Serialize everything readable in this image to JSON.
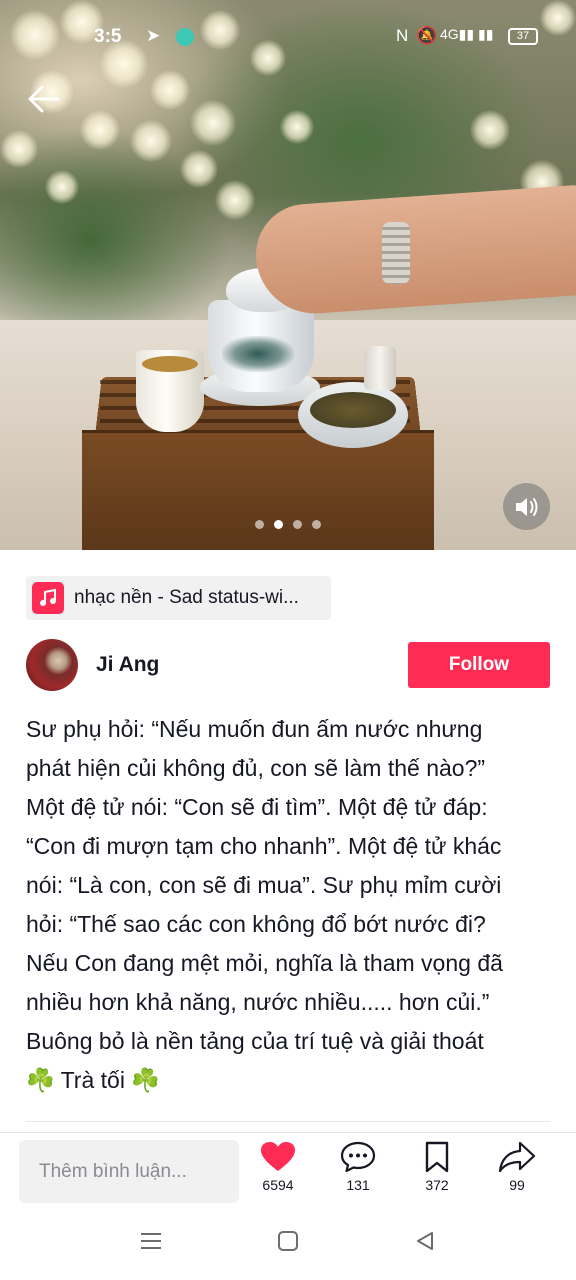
{
  "status_bar": {
    "time": "3:5",
    "battery": "37"
  },
  "music": {
    "label": "nhạc nền - Sad status-wi..."
  },
  "author": {
    "name": "Ji Ang",
    "follow_label": "Follow"
  },
  "caption": {
    "lines": [
      "Sư phụ hỏi: “Nếu muốn đun ấm nước nhưng",
      "phát hiện củi không đủ, con sẽ làm thế nào?”",
      "Một đệ tử nói: “Con sẽ đi tìm”. Một đệ tử đáp:",
      "“Con đi mượn tạm cho nhanh”. Một đệ tử khác",
      "nói: “Là con, con sẽ đi mua”. Sư phụ mỉm cười",
      "hỏi: “Thế sao các con không đổ bớt nước đi?",
      "Nếu Con đang mệt mỏi, nghĩa là tham vọng đã",
      "nhiều hơn khả năng, nước nhiều..... hơn củi.”",
      "Buông bỏ là nền tảng của trí tuệ và giải thoát",
      "☘️ Trà tối ☘️"
    ]
  },
  "carousel": {
    "count": 4,
    "active_index": 1
  },
  "bottom_bar": {
    "comment_placeholder": "Thêm bình luận...",
    "likes": "6594",
    "comments": "131",
    "saves": "372",
    "shares": "99"
  },
  "colors": {
    "accent": "#fe2c55",
    "text": "#161823",
    "muted": "#8a8b91"
  },
  "icons": [
    "back-arrow-icon",
    "sound-icon",
    "music-note-icon",
    "heart-icon",
    "comment-icon",
    "bookmark-icon",
    "share-icon",
    "menu-icon",
    "home-square-icon",
    "back-triangle-icon"
  ]
}
